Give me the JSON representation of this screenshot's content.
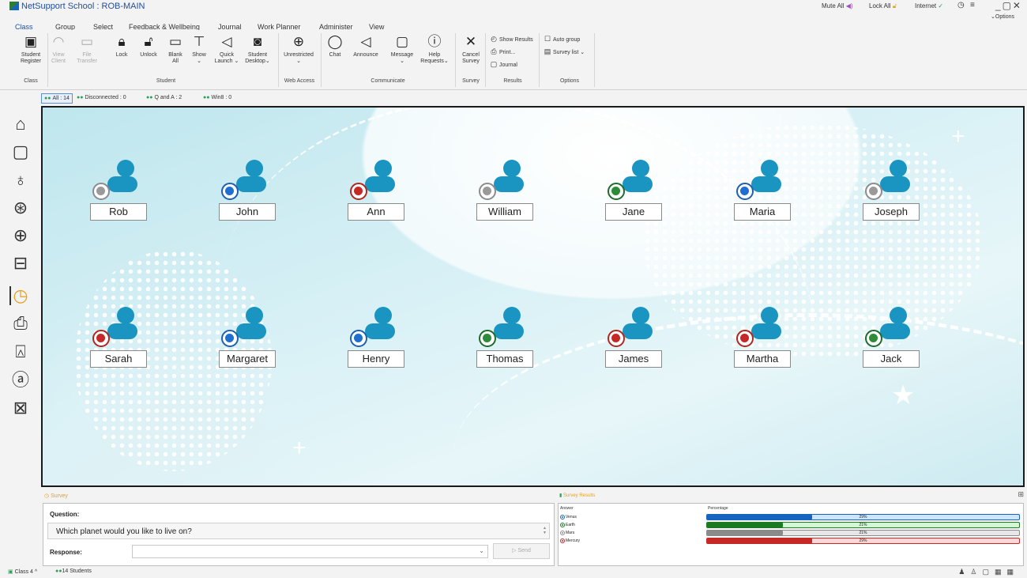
{
  "window": {
    "title": "NetSupport School : ROB-MAIN",
    "mute_all": "Mute All",
    "lock_all": "Lock All",
    "internet": "Internet",
    "options": "Options"
  },
  "menu": {
    "tabs": [
      "Class",
      "Group",
      "Select",
      "Feedback & Wellbeing",
      "Journal",
      "Work Planner",
      "Administer",
      "View"
    ]
  },
  "ribbon": {
    "buttons": [
      {
        "label": "Student\nRegister",
        "icon": "student-register-icon"
      },
      {
        "label": "View\nClient",
        "icon": "eye-icon"
      },
      {
        "label": "File\nTransfer",
        "icon": "folder-icon"
      },
      {
        "label": "Lock",
        "icon": "lock-icon"
      },
      {
        "label": "Unlock",
        "icon": "unlock-icon"
      },
      {
        "label": "Blank\nAll",
        "icon": "monitor-icon"
      },
      {
        "label": "Show\n⌄",
        "icon": "presentation-icon"
      },
      {
        "label": "Quick\nLaunch ⌄",
        "icon": "send-icon"
      },
      {
        "label": "Student\nDesktop⌄",
        "icon": "student-desktop-icon"
      },
      {
        "label": "Unrestricted\n⌄",
        "icon": "globe-icon"
      },
      {
        "label": "Chat",
        "icon": "chat-icon"
      },
      {
        "label": "Announce",
        "icon": "megaphone-icon"
      },
      {
        "label": "Message\n⌄",
        "icon": "message-icon"
      },
      {
        "label": "Help\nRequests⌄",
        "icon": "help-icon"
      },
      {
        "label": "Cancel\nSurvey",
        "icon": "close-icon"
      }
    ],
    "results_items": [
      "Show Results",
      "Print...",
      "Journal"
    ],
    "options_items": [
      "Auto group",
      "Survey list  ⌄"
    ],
    "groups": [
      "Class",
      "Student",
      "Web Access",
      "Communicate",
      "Survey",
      "Results",
      "Options"
    ]
  },
  "filters": [
    {
      "label": "All : 14"
    },
    {
      "label": "Disconnected : 0"
    },
    {
      "label": "Q and A : 2"
    },
    {
      "label": "Win8 : 0"
    }
  ],
  "sidebar": {
    "items": [
      "home-icon",
      "screen-icon",
      "microphone-icon",
      "settings-icon",
      "globe-icon",
      "browser-icon",
      "survey-icon",
      "printer-icon",
      "device-icon",
      "email-icon",
      "gallery-icon"
    ]
  },
  "students": [
    {
      "name": "Rob",
      "status": "grey"
    },
    {
      "name": "John",
      "status": "blue"
    },
    {
      "name": "Ann",
      "status": "red"
    },
    {
      "name": "William",
      "status": "grey"
    },
    {
      "name": "Jane",
      "status": "green"
    },
    {
      "name": "Maria",
      "status": "blue"
    },
    {
      "name": "Joseph",
      "status": "grey"
    },
    {
      "name": "Sarah",
      "status": "red"
    },
    {
      "name": "Margaret",
      "status": "blue"
    },
    {
      "name": "Henry",
      "status": "blue"
    },
    {
      "name": "Thomas",
      "status": "green"
    },
    {
      "name": "James",
      "status": "red"
    },
    {
      "name": "Martha",
      "status": "red"
    },
    {
      "name": "Jack",
      "status": "green"
    }
  ],
  "survey": {
    "title": "Survey",
    "question_label": "Question:",
    "question": "Which planet would you like to live on?",
    "response_label": "Response:",
    "send_label": "Send"
  },
  "results": {
    "title": "Survey Results",
    "answer_header": "Answer",
    "percent_header": "Percentage",
    "answers": [
      {
        "label": "Venus",
        "percent": 29,
        "pct_text": "29%",
        "color": "#1565c0",
        "track": "#cfe3fb"
      },
      {
        "label": "Earth",
        "percent": 21,
        "pct_text": "21%",
        "color": "#1b7a23",
        "track": "#d4f7d6"
      },
      {
        "label": "Mars",
        "percent": 21,
        "pct_text": "21%",
        "color": "#8a8a8a",
        "track": "#e6e6e6"
      },
      {
        "label": "Mercury",
        "percent": 29,
        "pct_text": "29%",
        "color": "#c62828",
        "track": "#fbd9d9"
      }
    ]
  },
  "statusbar": {
    "class_label": "Class 4",
    "students_label": "14 Students"
  }
}
